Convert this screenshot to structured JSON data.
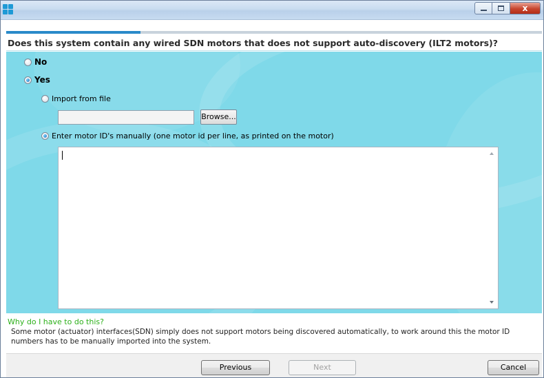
{
  "window": {
    "title": "",
    "close_glyph": "x"
  },
  "progress": {
    "fraction": 0.25
  },
  "question": "Does this system contain any wired SDN motors that does not support auto-discovery (ILT2 motors)?",
  "options": {
    "no_label": "No",
    "yes_label": "Yes",
    "import_label": "Import from file",
    "file_path_value": "",
    "browse_label": "Browse...",
    "manual_label": "Enter motor ID's manually (one motor id per line, as printed on the motor)",
    "manual_value": ""
  },
  "selection": {
    "main": "yes",
    "sub": "manual"
  },
  "help": {
    "title": "Why do I have to do this?",
    "text": "Some motor (actuator) interfaces(SDN) simply does not support motors being discovered automatically, to work around this the motor ID numbers has to be manually imported into the system."
  },
  "footer": {
    "previous_label": "Previous",
    "next_label": "Next",
    "cancel_label": "Cancel"
  },
  "colors": {
    "content_bg": "#7fd9e9",
    "progress": "#2a8ac9",
    "help_title": "#2db01a"
  },
  "icons": [
    "app-icon",
    "minimize-icon",
    "maximize-icon",
    "close-icon",
    "scroll-up-icon",
    "scroll-down-icon"
  ]
}
